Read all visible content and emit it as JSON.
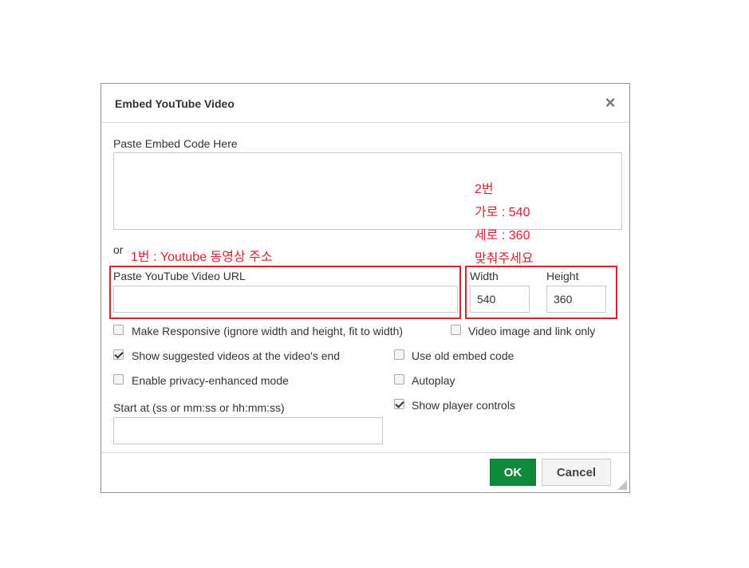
{
  "dialog": {
    "title": "Embed YouTube Video",
    "close_icon": "close-icon",
    "embed_code_label": "Paste Embed Code Here",
    "embed_code_value": "",
    "or_label": "or",
    "url_label": "Paste YouTube Video URL",
    "url_value": "",
    "width_label": "Width",
    "width_value": "540",
    "height_label": "Height",
    "height_value": "360",
    "start_label": "Start at (ss or mm:ss or hh:mm:ss)",
    "start_value": "",
    "options": {
      "make_responsive": {
        "label": "Make Responsive (ignore width and height, fit to width)",
        "checked": false
      },
      "video_image_link": {
        "label": "Video image and link only",
        "checked": false
      },
      "show_suggested": {
        "label": "Show suggested videos at the video's end",
        "checked": true
      },
      "use_old_embed": {
        "label": "Use old embed code",
        "checked": false
      },
      "privacy_mode": {
        "label": "Enable privacy-enhanced mode",
        "checked": false
      },
      "autoplay": {
        "label": "Autoplay",
        "checked": false
      },
      "player_controls": {
        "label": "Show player controls",
        "checked": true
      }
    },
    "ok_label": "OK",
    "cancel_label": "Cancel"
  },
  "annotations": {
    "note1": "1번 : Youtube 동영상 주소",
    "note2_line1": "2번",
    "note2_line2": "가로 : 540",
    "note2_line3": "세로 : 360",
    "note2_line4": "맞춰주세요",
    "color": "#e0202c"
  },
  "colors": {
    "ok_button": "#0f8a3a"
  }
}
